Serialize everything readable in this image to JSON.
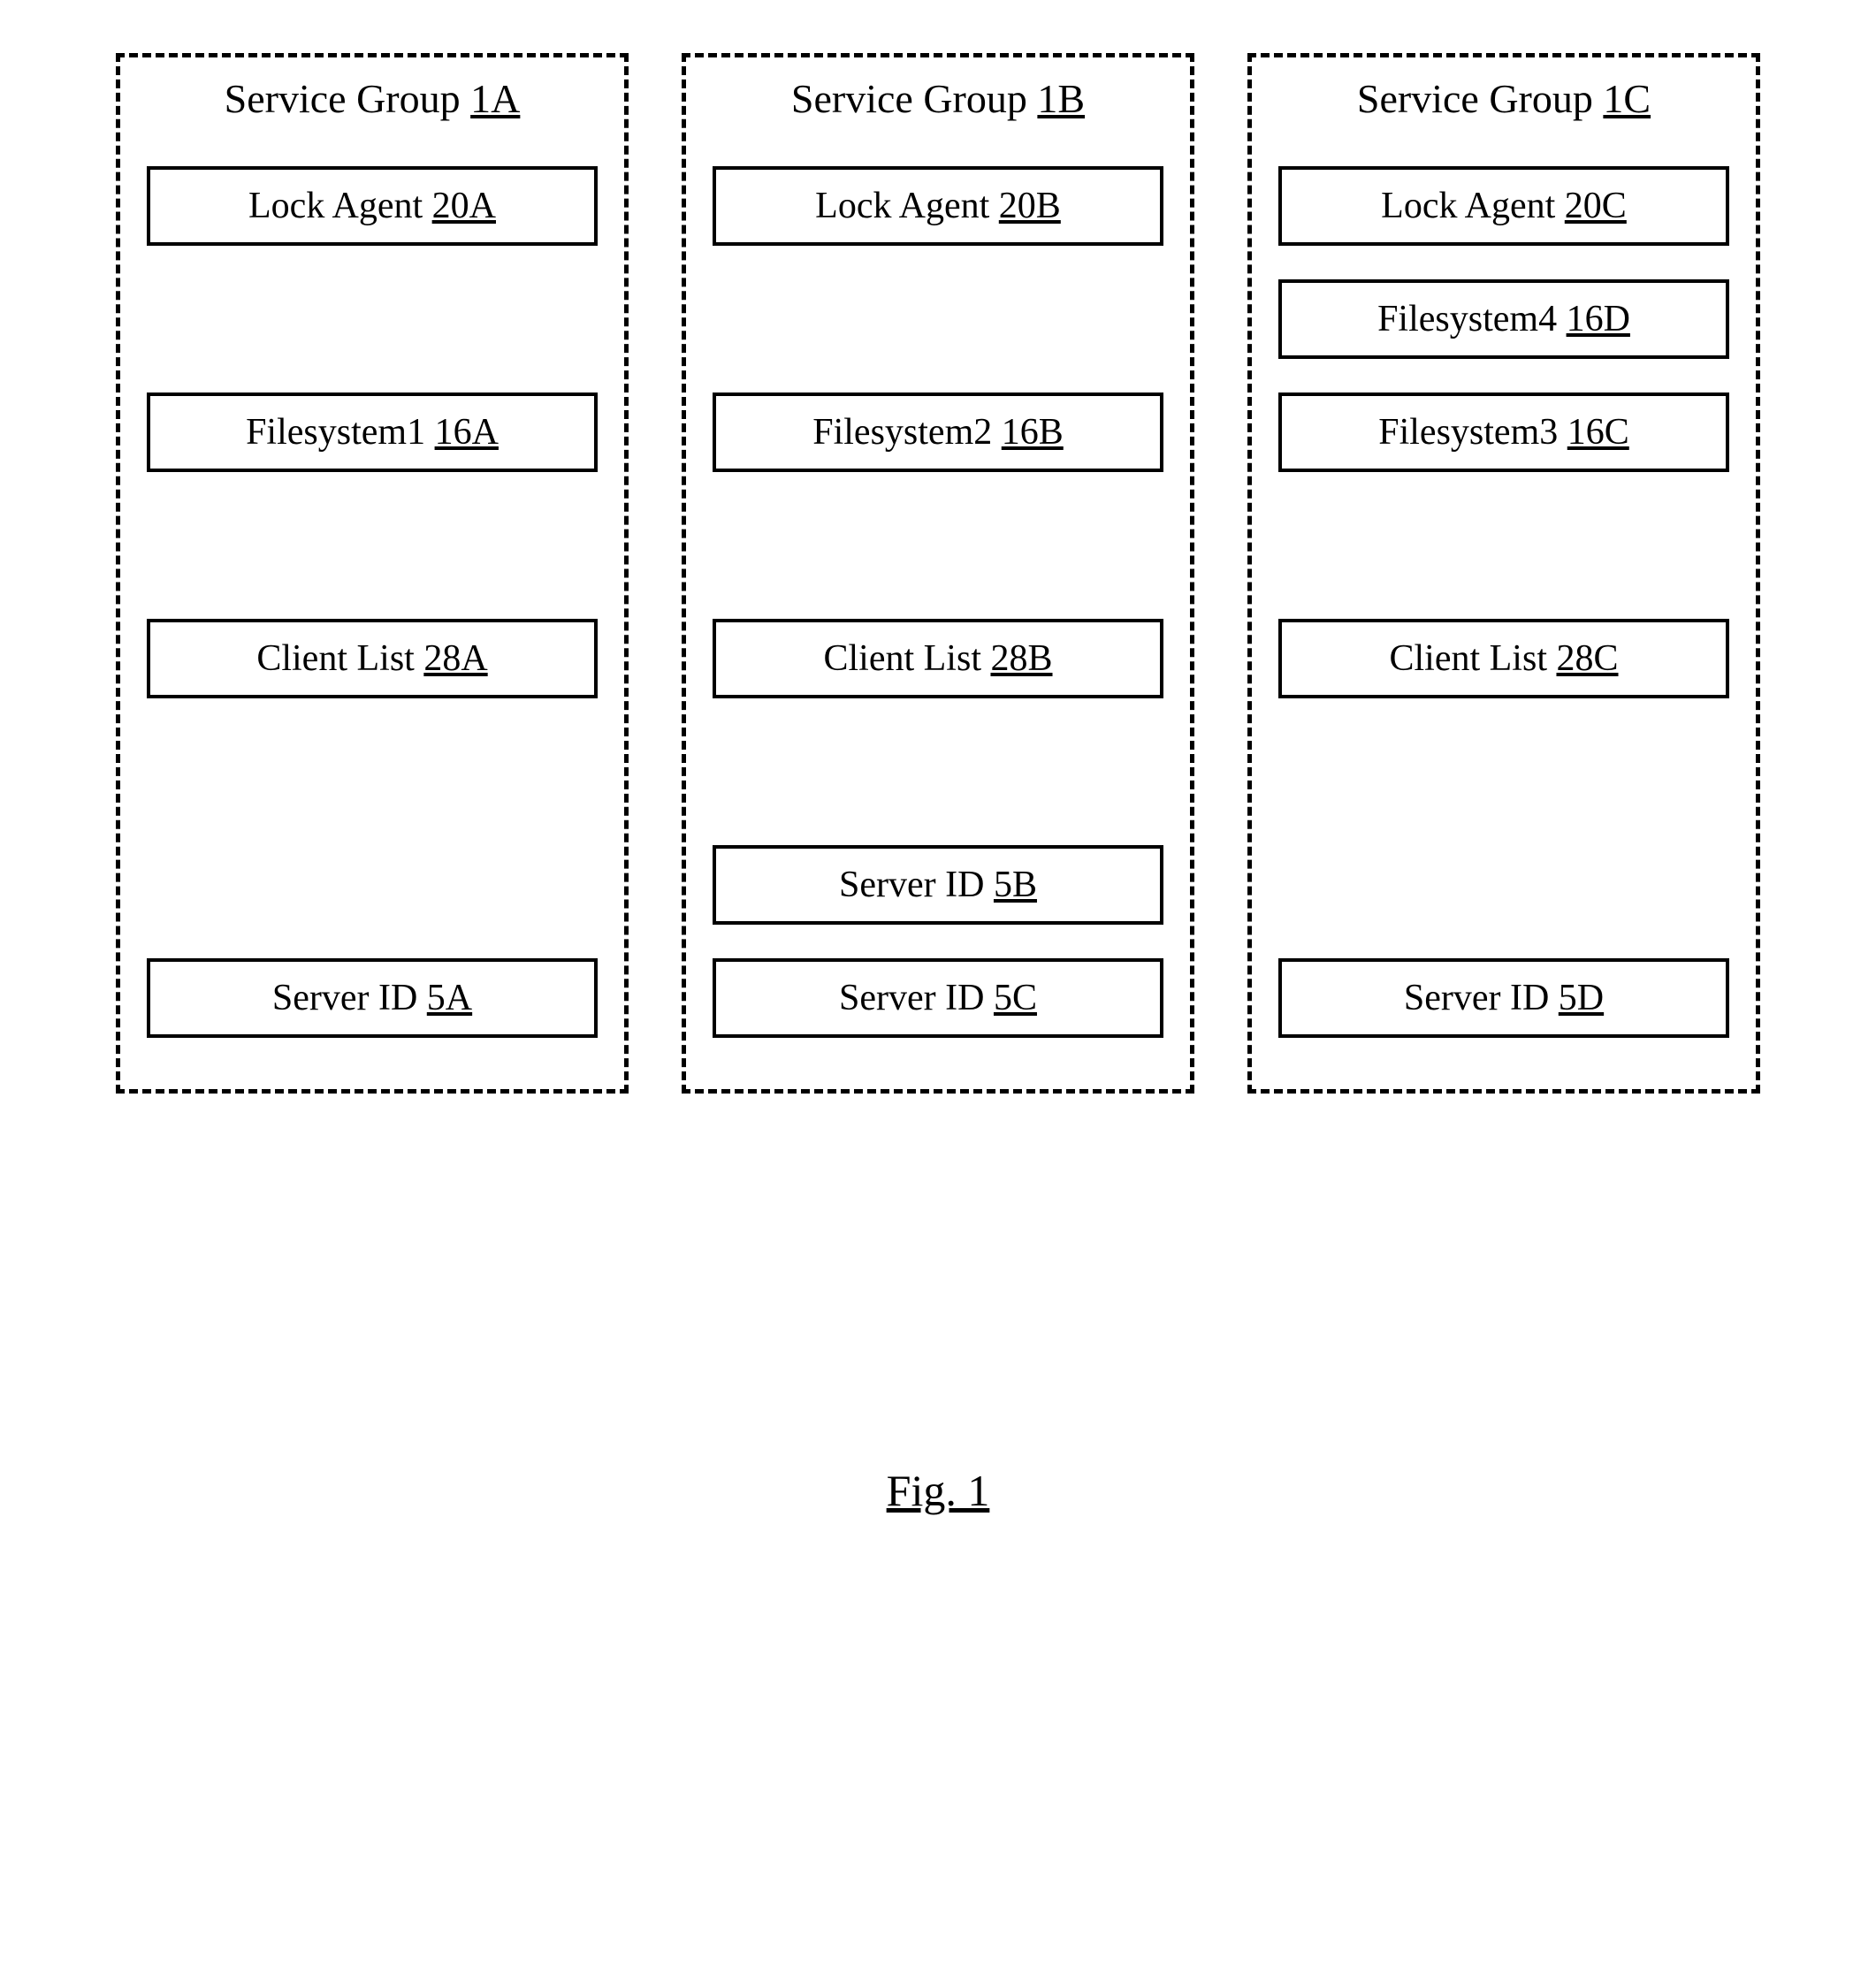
{
  "figure_label": "Fig. 1",
  "groups": [
    {
      "title_prefix": "Service Group ",
      "title_ref": "1A",
      "rows": [
        {
          "kind": "box",
          "label": "Lock Agent ",
          "ref": "20A"
        },
        {
          "kind": "gap"
        },
        {
          "kind": "box",
          "label": "Filesystem1 ",
          "ref": "16A"
        },
        {
          "kind": "gap"
        },
        {
          "kind": "box",
          "label": "Client List ",
          "ref": "28A"
        },
        {
          "kind": "gap"
        },
        {
          "kind": "gap"
        },
        {
          "kind": "box",
          "label": "Server ID ",
          "ref": "5A"
        }
      ]
    },
    {
      "title_prefix": "Service Group ",
      "title_ref": "1B",
      "rows": [
        {
          "kind": "box",
          "label": "Lock Agent ",
          "ref": "20B"
        },
        {
          "kind": "gap"
        },
        {
          "kind": "box",
          "label": "Filesystem2 ",
          "ref": "16B"
        },
        {
          "kind": "gap"
        },
        {
          "kind": "box",
          "label": "Client List ",
          "ref": "28B"
        },
        {
          "kind": "gap"
        },
        {
          "kind": "box",
          "label": "Server ID ",
          "ref": "5B"
        },
        {
          "kind": "box",
          "label": "Server ID ",
          "ref": "5C"
        }
      ]
    },
    {
      "title_prefix": "Service Group ",
      "title_ref": "1C",
      "rows": [
        {
          "kind": "box",
          "label": "Lock Agent ",
          "ref": "20C"
        },
        {
          "kind": "box",
          "label": "Filesystem4 ",
          "ref": "16D"
        },
        {
          "kind": "box",
          "label": "Filesystem3 ",
          "ref": "16C"
        },
        {
          "kind": "gap"
        },
        {
          "kind": "box",
          "label": "Client List ",
          "ref": "28C"
        },
        {
          "kind": "gap"
        },
        {
          "kind": "gap"
        },
        {
          "kind": "box",
          "label": "Server ID ",
          "ref": "5D"
        }
      ]
    }
  ]
}
